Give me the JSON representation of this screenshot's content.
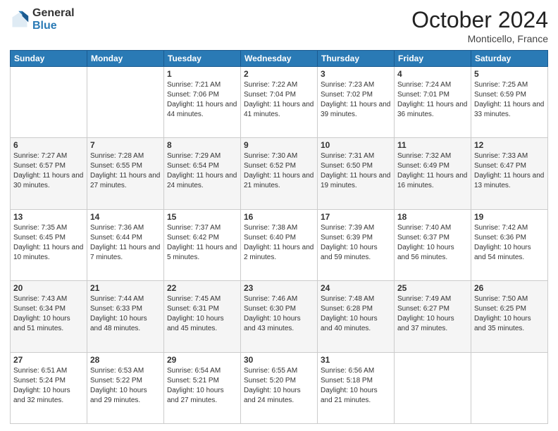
{
  "header": {
    "logo_general": "General",
    "logo_blue": "Blue",
    "month_title": "October 2024",
    "location": "Monticello, France"
  },
  "days_header": [
    "Sunday",
    "Monday",
    "Tuesday",
    "Wednesday",
    "Thursday",
    "Friday",
    "Saturday"
  ],
  "weeks": [
    [
      {
        "num": "",
        "info": ""
      },
      {
        "num": "",
        "info": ""
      },
      {
        "num": "1",
        "info": "Sunrise: 7:21 AM\nSunset: 7:06 PM\nDaylight: 11 hours and 44 minutes."
      },
      {
        "num": "2",
        "info": "Sunrise: 7:22 AM\nSunset: 7:04 PM\nDaylight: 11 hours and 41 minutes."
      },
      {
        "num": "3",
        "info": "Sunrise: 7:23 AM\nSunset: 7:02 PM\nDaylight: 11 hours and 39 minutes."
      },
      {
        "num": "4",
        "info": "Sunrise: 7:24 AM\nSunset: 7:01 PM\nDaylight: 11 hours and 36 minutes."
      },
      {
        "num": "5",
        "info": "Sunrise: 7:25 AM\nSunset: 6:59 PM\nDaylight: 11 hours and 33 minutes."
      }
    ],
    [
      {
        "num": "6",
        "info": "Sunrise: 7:27 AM\nSunset: 6:57 PM\nDaylight: 11 hours and 30 minutes."
      },
      {
        "num": "7",
        "info": "Sunrise: 7:28 AM\nSunset: 6:55 PM\nDaylight: 11 hours and 27 minutes."
      },
      {
        "num": "8",
        "info": "Sunrise: 7:29 AM\nSunset: 6:54 PM\nDaylight: 11 hours and 24 minutes."
      },
      {
        "num": "9",
        "info": "Sunrise: 7:30 AM\nSunset: 6:52 PM\nDaylight: 11 hours and 21 minutes."
      },
      {
        "num": "10",
        "info": "Sunrise: 7:31 AM\nSunset: 6:50 PM\nDaylight: 11 hours and 19 minutes."
      },
      {
        "num": "11",
        "info": "Sunrise: 7:32 AM\nSunset: 6:49 PM\nDaylight: 11 hours and 16 minutes."
      },
      {
        "num": "12",
        "info": "Sunrise: 7:33 AM\nSunset: 6:47 PM\nDaylight: 11 hours and 13 minutes."
      }
    ],
    [
      {
        "num": "13",
        "info": "Sunrise: 7:35 AM\nSunset: 6:45 PM\nDaylight: 11 hours and 10 minutes."
      },
      {
        "num": "14",
        "info": "Sunrise: 7:36 AM\nSunset: 6:44 PM\nDaylight: 11 hours and 7 minutes."
      },
      {
        "num": "15",
        "info": "Sunrise: 7:37 AM\nSunset: 6:42 PM\nDaylight: 11 hours and 5 minutes."
      },
      {
        "num": "16",
        "info": "Sunrise: 7:38 AM\nSunset: 6:40 PM\nDaylight: 11 hours and 2 minutes."
      },
      {
        "num": "17",
        "info": "Sunrise: 7:39 AM\nSunset: 6:39 PM\nDaylight: 10 hours and 59 minutes."
      },
      {
        "num": "18",
        "info": "Sunrise: 7:40 AM\nSunset: 6:37 PM\nDaylight: 10 hours and 56 minutes."
      },
      {
        "num": "19",
        "info": "Sunrise: 7:42 AM\nSunset: 6:36 PM\nDaylight: 10 hours and 54 minutes."
      }
    ],
    [
      {
        "num": "20",
        "info": "Sunrise: 7:43 AM\nSunset: 6:34 PM\nDaylight: 10 hours and 51 minutes."
      },
      {
        "num": "21",
        "info": "Sunrise: 7:44 AM\nSunset: 6:33 PM\nDaylight: 10 hours and 48 minutes."
      },
      {
        "num": "22",
        "info": "Sunrise: 7:45 AM\nSunset: 6:31 PM\nDaylight: 10 hours and 45 minutes."
      },
      {
        "num": "23",
        "info": "Sunrise: 7:46 AM\nSunset: 6:30 PM\nDaylight: 10 hours and 43 minutes."
      },
      {
        "num": "24",
        "info": "Sunrise: 7:48 AM\nSunset: 6:28 PM\nDaylight: 10 hours and 40 minutes."
      },
      {
        "num": "25",
        "info": "Sunrise: 7:49 AM\nSunset: 6:27 PM\nDaylight: 10 hours and 37 minutes."
      },
      {
        "num": "26",
        "info": "Sunrise: 7:50 AM\nSunset: 6:25 PM\nDaylight: 10 hours and 35 minutes."
      }
    ],
    [
      {
        "num": "27",
        "info": "Sunrise: 6:51 AM\nSunset: 5:24 PM\nDaylight: 10 hours and 32 minutes."
      },
      {
        "num": "28",
        "info": "Sunrise: 6:53 AM\nSunset: 5:22 PM\nDaylight: 10 hours and 29 minutes."
      },
      {
        "num": "29",
        "info": "Sunrise: 6:54 AM\nSunset: 5:21 PM\nDaylight: 10 hours and 27 minutes."
      },
      {
        "num": "30",
        "info": "Sunrise: 6:55 AM\nSunset: 5:20 PM\nDaylight: 10 hours and 24 minutes."
      },
      {
        "num": "31",
        "info": "Sunrise: 6:56 AM\nSunset: 5:18 PM\nDaylight: 10 hours and 21 minutes."
      },
      {
        "num": "",
        "info": ""
      },
      {
        "num": "",
        "info": ""
      }
    ]
  ]
}
